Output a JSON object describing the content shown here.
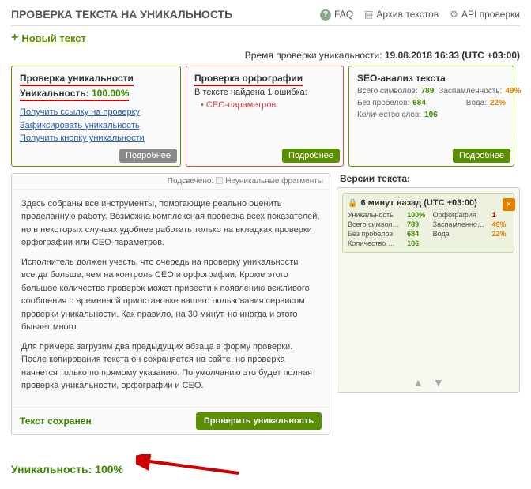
{
  "header": {
    "title": "ПРОВЕРКА ТЕКСТА НА УНИКАЛЬНОСТЬ",
    "links": {
      "faq": "FAQ",
      "archive": "Архив текстов",
      "api": "API проверки"
    },
    "new_text": "Новый текст"
  },
  "timestamp": {
    "label": "Время проверки уникальности:",
    "value": "19.08.2018 16:33 (UTC +03:00)"
  },
  "panel_uniq": {
    "title": "Проверка уникальности",
    "label": "Уникальность:",
    "value": "100.00%",
    "links": {
      "get": "Получить ссылку на проверку",
      "fix": "Зафиксировать уникальность",
      "button": "Получить кнопку уникальности"
    },
    "more": "Подробнее"
  },
  "panel_spell": {
    "title": "Проверка орфографии",
    "found": "В тексте найдена 1 ошибка:",
    "item": "СЕО-параметров",
    "more": "Подробнее"
  },
  "panel_seo": {
    "title": "SEO-анализ текста",
    "stats": {
      "all_chars_l": "Всего символов:",
      "all_chars_v": "789",
      "nospace_l": "Без пробелов:",
      "nospace_v": "684",
      "words_l": "Количество слов:",
      "words_v": "106",
      "spam_l": "Заспамленность:",
      "spam_v": "49%",
      "water_l": "Вода:",
      "water_v": "22%"
    },
    "more": "Подробнее"
  },
  "highlight": {
    "label": "Подсвечено:",
    "legend": "Неуникальные фрагменты"
  },
  "text": {
    "p1": "Здесь собраны все инструменты, помогающие реально оценить проделанную работу. Возможна комплексная проверка всех показателей, но в некоторых случаях удобнее работать только на вкладках проверки орфографии или СЕО-параметров.",
    "p2": "Исполнитель должен учесть, что очередь на проверку уникальности всегда больше, чем на контроль СЕО и орфографии. Кроме этого большое количество проверок может привести к появлению вежливого сообщения о временной приостановке вашего пользования сервисом проверки уникальности. Как правило, на 30 минут, но иногда и этого бывает много.",
    "p3": "Для примера загрузим два предыдущих абзаца в форму проверки. После копирования текста он сохраняется на сайте, но проверка начнется только по прямому указанию. По умолчанию это будет полная проверка уникальности, орфографии и СЕО."
  },
  "footer": {
    "saved": "Текст сохранен",
    "check": "Проверить уникальность"
  },
  "versions": {
    "title": "Версии текста:",
    "time": "6 минут назад  (UTC +03:00)",
    "rows": {
      "uniq_l": "Уникальность",
      "uniq_v": "100%",
      "orth_l": "Орфография",
      "orth_v": "1",
      "chars_l": "Всего символ…",
      "chars_v": "789",
      "spam_l": "Заспамленно…",
      "spam_v": "49%",
      "nosp_l": "Без пробелов",
      "nosp_v": "684",
      "water_l": "Вода",
      "water_v": "22%",
      "words_l": "Количество …",
      "words_v": "106"
    }
  },
  "result": {
    "label": "Уникальность: 100%"
  }
}
